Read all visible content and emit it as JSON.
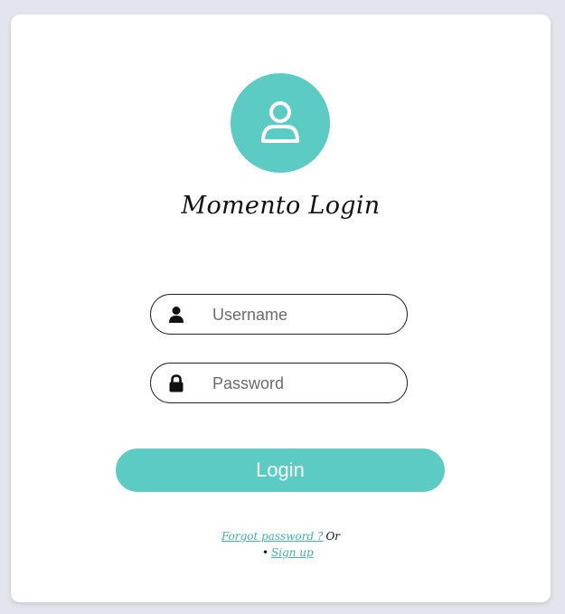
{
  "page": {
    "title": "Momento Login"
  },
  "form": {
    "username_placeholder": "Username",
    "password_placeholder": "Password",
    "login_label": "Login"
  },
  "links": {
    "forgot_password": "Forgot password ?",
    "or_text": "Or",
    "sign_up": "Sign up"
  },
  "icons": {
    "avatar": "user-icon",
    "username": "user-icon",
    "password": "lock-icon"
  },
  "colors": {
    "accent": "#5ccbc3",
    "background": "#e3e5ec",
    "card": "#ffffff",
    "link": "#3fb3ab"
  }
}
